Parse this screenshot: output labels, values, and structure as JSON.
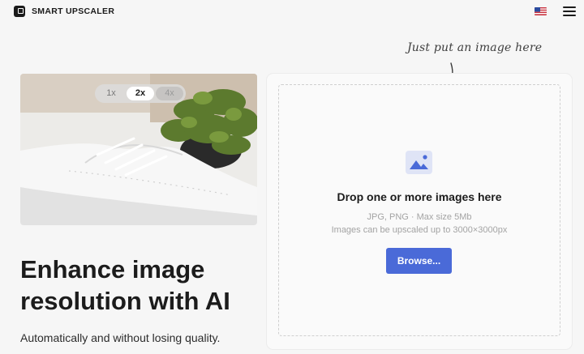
{
  "header": {
    "brand": "SMART UPSCALER",
    "language_flag": "us-flag-icon",
    "menu_icon": "hamburger-menu-icon"
  },
  "hint": {
    "text": "Just put an image here",
    "arrow_icon": "curved-arrow-down-icon"
  },
  "hero": {
    "image": "white-sneaker-with-plant-photo",
    "scale_options": [
      "1x",
      "2x",
      "4x"
    ],
    "selected_scale": "2x"
  },
  "main": {
    "title": "Enhance image resolution with AI",
    "subtitle": "Automatically and without losing quality."
  },
  "dropzone": {
    "icon": "image-upload-icon",
    "title": "Drop one or more images here",
    "info_formats": "JPG, PNG · Max size 5Mb",
    "info_limit": "Images can be upscaled up to 3000×3000px",
    "browse_label": "Browse..."
  },
  "colors": {
    "accent": "#4a6ad8",
    "background": "#f6f6f6",
    "text": "#1c1c1c"
  }
}
